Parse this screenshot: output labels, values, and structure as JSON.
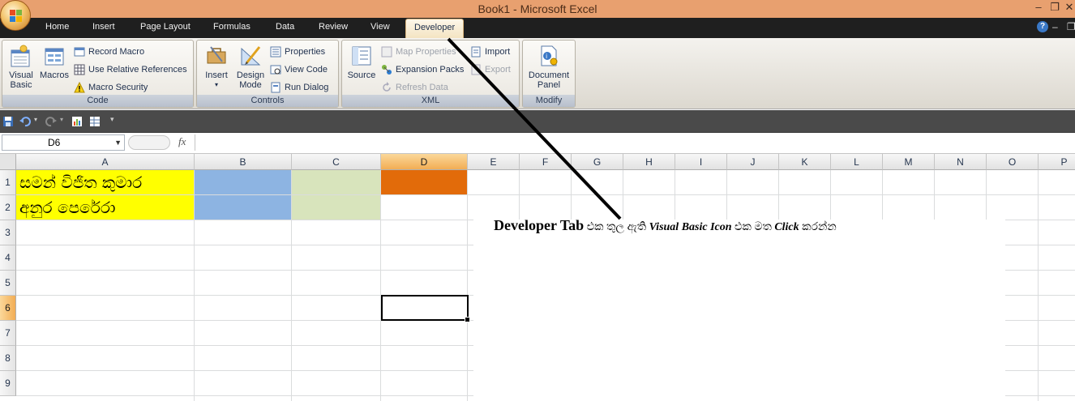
{
  "window": {
    "title": "Book1 - Microsoft Excel",
    "controls": [
      "–",
      "❐",
      "✕"
    ]
  },
  "tabs": [
    "Home",
    "Insert",
    "Page Layout",
    "Formulas",
    "Data",
    "Review",
    "View",
    "Developer"
  ],
  "active_tab": "Developer",
  "ribbon": {
    "code": {
      "label": "Code",
      "visual_basic": "Visual Basic",
      "macros": "Macros",
      "record_macro": "Record Macro",
      "use_relative": "Use Relative References",
      "macro_security": "Macro Security"
    },
    "controls": {
      "label": "Controls",
      "insert": "Insert",
      "design_mode": "Design Mode",
      "properties": "Properties",
      "view_code": "View Code",
      "run_dialog": "Run Dialog"
    },
    "xml": {
      "label": "XML",
      "source": "Source",
      "map_properties": "Map Properties",
      "expansion_packs": "Expansion Packs",
      "refresh_data": "Refresh Data",
      "import": "Import",
      "export": "Export"
    },
    "modify": {
      "label": "Modify",
      "document_panel": "Document Panel"
    }
  },
  "formula_bar": {
    "name_box": "D6",
    "fx": "fx",
    "content": ""
  },
  "sheet": {
    "columns": [
      "A",
      "B",
      "C",
      "D",
      "E",
      "F",
      "G",
      "H",
      "I",
      "J",
      "K",
      "L",
      "M",
      "N",
      "O",
      "P"
    ],
    "rows": [
      "1",
      "2",
      "3",
      "4",
      "5",
      "6",
      "7",
      "8",
      "9"
    ],
    "selected_cell": "D6",
    "cells": {
      "A1": "සමන් විජිත කුමාර",
      "A2": "අනුර පෙරේරා"
    },
    "fills": {
      "A1": "#ffff00",
      "A2": "#ffff00",
      "B1": "#8db4e2",
      "B2": "#8db4e2",
      "C1": "#d8e4bc",
      "C2": "#d8e4bc",
      "D1": "#e26b0a"
    }
  },
  "annotation": {
    "part1": "Developer Tab",
    "part2": " එක තුල ඇති ",
    "part3": "Visual Basic Icon",
    "part4": " එක මත ",
    "part5": "Click",
    "part6": " කරන්න"
  }
}
